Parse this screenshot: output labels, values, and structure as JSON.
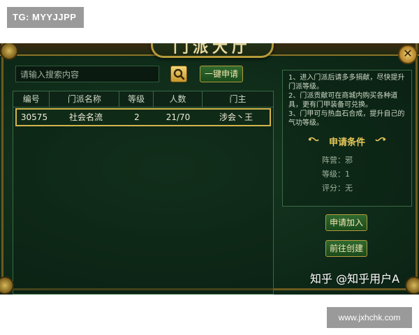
{
  "watermarks": {
    "telegram": "TG: MYYJJPP",
    "site": "www.jxhchk.com",
    "zhihu": "知乎 @知乎用户A"
  },
  "window": {
    "title": "门派大厅"
  },
  "search": {
    "placeholder": "请输入搜索内容",
    "search_icon": "search-icon",
    "apply_one_click": "一键申请"
  },
  "table": {
    "columns": [
      "编号",
      "门派名称",
      "等级",
      "人数",
      "门主"
    ],
    "rows": [
      [
        "30575",
        "社会名流",
        "2",
        "21/70",
        "涉会丶王"
      ]
    ]
  },
  "info": {
    "rules": [
      "1、进入门派后请多多捐献，尽快提升门派等级。",
      "2、门派贡献可在商城内购买各种道具，更有门甲装备可兑换。",
      "3、门甲可与热血石合成，提升自己的气功等级。"
    ],
    "conditions_title": "申请条件",
    "conditions": {
      "camp": "阵营：邪",
      "level": "等级：1",
      "rating": "评分：无"
    }
  },
  "buttons": {
    "join": "申请加入",
    "create": "前往创建"
  },
  "colors": {
    "panel_bg": "#0f2b19",
    "gold_border": "#b69a3a",
    "highlight_border": "#d4b44a"
  }
}
